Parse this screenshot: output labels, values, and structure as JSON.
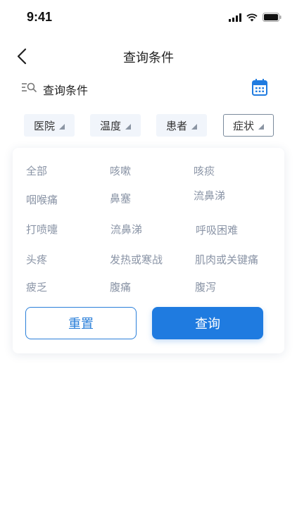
{
  "status_bar": {
    "time": "9:41"
  },
  "nav": {
    "title": "查询条件"
  },
  "search": {
    "label": "查询条件"
  },
  "filters": [
    {
      "label": "医院",
      "active": false
    },
    {
      "label": "温度",
      "active": false
    },
    {
      "label": "患者",
      "active": false
    },
    {
      "label": "症状",
      "active": true
    }
  ],
  "symptoms": [
    "全部",
    "咳嗽",
    "咳痰",
    "咽喉痛",
    "鼻塞",
    "流鼻涕",
    "打喷嚏",
    "流鼻涕",
    "呼吸困难",
    "头疼",
    "发热或寒战",
    "肌肉或关键痛",
    "疲乏",
    "腹痛",
    "腹泻"
  ],
  "actions": {
    "reset_label": "重置",
    "query_label": "查询"
  },
  "colors": {
    "accent": "#1f7be0",
    "option_text": "#8a94a6",
    "tab_bg": "#f1f5fb"
  }
}
